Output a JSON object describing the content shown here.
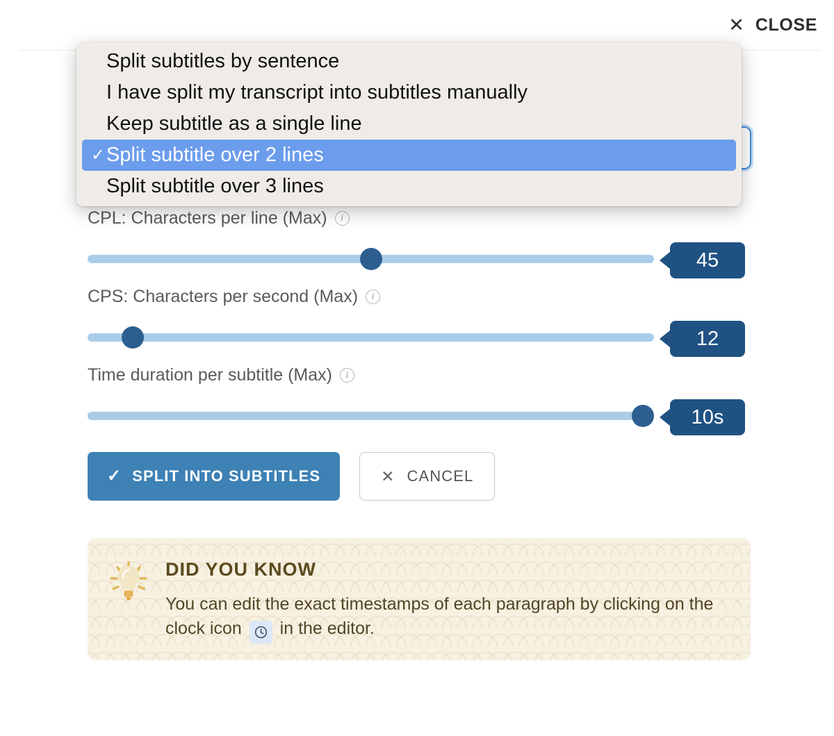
{
  "header": {
    "close_label": "CLOSE",
    "close_icon": "close-x-icon"
  },
  "dropdown": {
    "open": true,
    "selected_index": 3,
    "items": [
      {
        "label": "Split subtitles by sentence",
        "checked": false
      },
      {
        "label": "I have split my transcript into subtitles manually",
        "checked": false
      },
      {
        "label": "Keep subtitle as a single line",
        "checked": false
      },
      {
        "label": "Split subtitle over 2 lines",
        "checked": true
      },
      {
        "label": "Split subtitle over 3 lines",
        "checked": false
      }
    ],
    "check_glyph": "✓",
    "highlight_color": "#6c9dec"
  },
  "sliders": [
    {
      "label": "CPL: Characters per line (Max)",
      "info_glyph": "i",
      "value": "45",
      "fill_percent": 50
    },
    {
      "label": "CPS: Characters per second (Max)",
      "info_glyph": "i",
      "value": "12",
      "fill_percent": 8
    },
    {
      "label": "Time duration per subtitle (Max)",
      "info_glyph": "i",
      "value": "10s",
      "fill_percent": 98
    }
  ],
  "actions": {
    "primary_label": "SPLIT INTO SUBTITLES",
    "primary_icon": "check-icon",
    "primary_color": "#3d81b5",
    "secondary_label": "CANCEL",
    "secondary_icon": "close-x-icon"
  },
  "tip": {
    "title": "DID YOU KNOW",
    "icon": "lightbulb-icon",
    "text_before": "You can edit the exact timestamps of each paragraph by clicking on the clock icon",
    "inline_icon": "clock-icon",
    "text_after": "in the editor.",
    "background_color": "#f7f1e2"
  }
}
